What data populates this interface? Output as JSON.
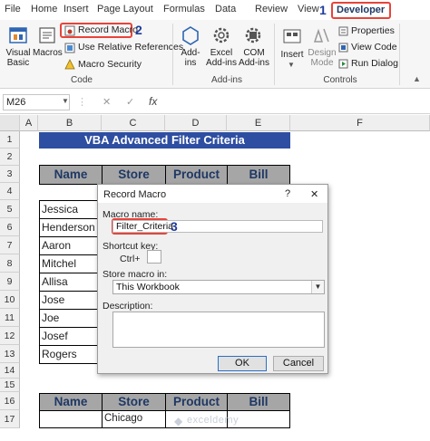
{
  "tabs": [
    "File",
    "Home",
    "Insert",
    "Page Layout",
    "Formulas",
    "Data",
    "Review",
    "View",
    "Developer"
  ],
  "step_numbers": [
    "1",
    "2",
    "3"
  ],
  "ribbon": {
    "code_group": {
      "visual_basic": [
        "Visual",
        "Basic"
      ],
      "macros": "Macros",
      "record_macro": "Record Macro",
      "use_relative": "Use Relative References",
      "macro_security": "Macro Security",
      "label": "Code"
    },
    "addins_group": {
      "addins": [
        "Add-",
        "ins"
      ],
      "excel_addins": [
        "Excel",
        "Add-ins"
      ],
      "com_addins": [
        "COM",
        "Add-ins"
      ],
      "label": "Add-ins"
    },
    "controls_group": {
      "insert": "Insert",
      "design_mode": [
        "Design",
        "Mode"
      ],
      "properties": "Properties",
      "view_code": "View Code",
      "run_dialog": "Run Dialog",
      "label": "Controls"
    }
  },
  "formula_bar": {
    "name_box": "M26",
    "cancel": "✕",
    "enter": "✓",
    "fx": "fx",
    "value": ""
  },
  "columns": [
    "A",
    "B",
    "C",
    "D",
    "E",
    "F"
  ],
  "rows": [
    "1",
    "2",
    "3",
    "4",
    "5",
    "6",
    "7",
    "8",
    "9",
    "10",
    "11",
    "12",
    "13",
    "14",
    "15",
    "16",
    "17"
  ],
  "sheet": {
    "title": "VBA Advanced Filter Criteria",
    "headers": [
      "Name",
      "Store",
      "Product",
      "Bill"
    ],
    "names": [
      "Jessica",
      "Henderson",
      "Aaron",
      "Mitchel",
      "Allisa",
      "Jose",
      "Joe",
      "Josef",
      "Rogers"
    ],
    "criteria_headers": [
      "Name",
      "Store",
      "Product",
      "Bill"
    ],
    "criteria_store": "Chicago"
  },
  "dialog": {
    "title": "Record Macro",
    "help": "?",
    "close": "✕",
    "macro_name_label": "Macro name:",
    "macro_name_value": "Filter_Criteria",
    "shortcut_label": "Shortcut key:",
    "ctrl_label": "Ctrl+",
    "shortcut_value": "",
    "store_in_label": "Store macro in:",
    "store_in_value": "This Workbook",
    "description_label": "Description:",
    "description_value": "",
    "ok": "OK",
    "cancel": "Cancel"
  },
  "watermark": "exceldemy",
  "colors": {
    "accent_red": "#e8433a",
    "title_band": "#2e4ea1",
    "header_fill": "#a6a6a6",
    "step_blue": "#1f3c9c"
  }
}
